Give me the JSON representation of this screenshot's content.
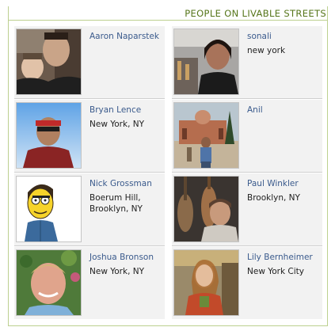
{
  "widget": {
    "title": "PEOPLE ON LIVABLE STREETS"
  },
  "people": [
    {
      "name": "Aaron Naparstek",
      "location": "",
      "photo": "person-photo"
    },
    {
      "name": "sonali",
      "location": "new york",
      "photo": "person-photo"
    },
    {
      "name": "Bryan Lence",
      "location": "New York, NY",
      "photo": "person-photo"
    },
    {
      "name": "Anil",
      "location": "",
      "photo": "person-photo"
    },
    {
      "name": "Nick Grossman",
      "location": "Boerum Hill, Brooklyn, NY",
      "photo": "cartoon-avatar"
    },
    {
      "name": "Paul Winkler",
      "location": "Brooklyn, NY",
      "photo": "person-photo"
    },
    {
      "name": "Joshua Bronson",
      "location": "New York, NY",
      "photo": "person-photo"
    },
    {
      "name": "Lily Bernheimer",
      "location": "New York City",
      "photo": "person-photo"
    }
  ],
  "colors": {
    "title": "#56761a",
    "border": "#bcd08f",
    "card_background": "#f2f2f2",
    "name_link": "#3a5a8c"
  }
}
